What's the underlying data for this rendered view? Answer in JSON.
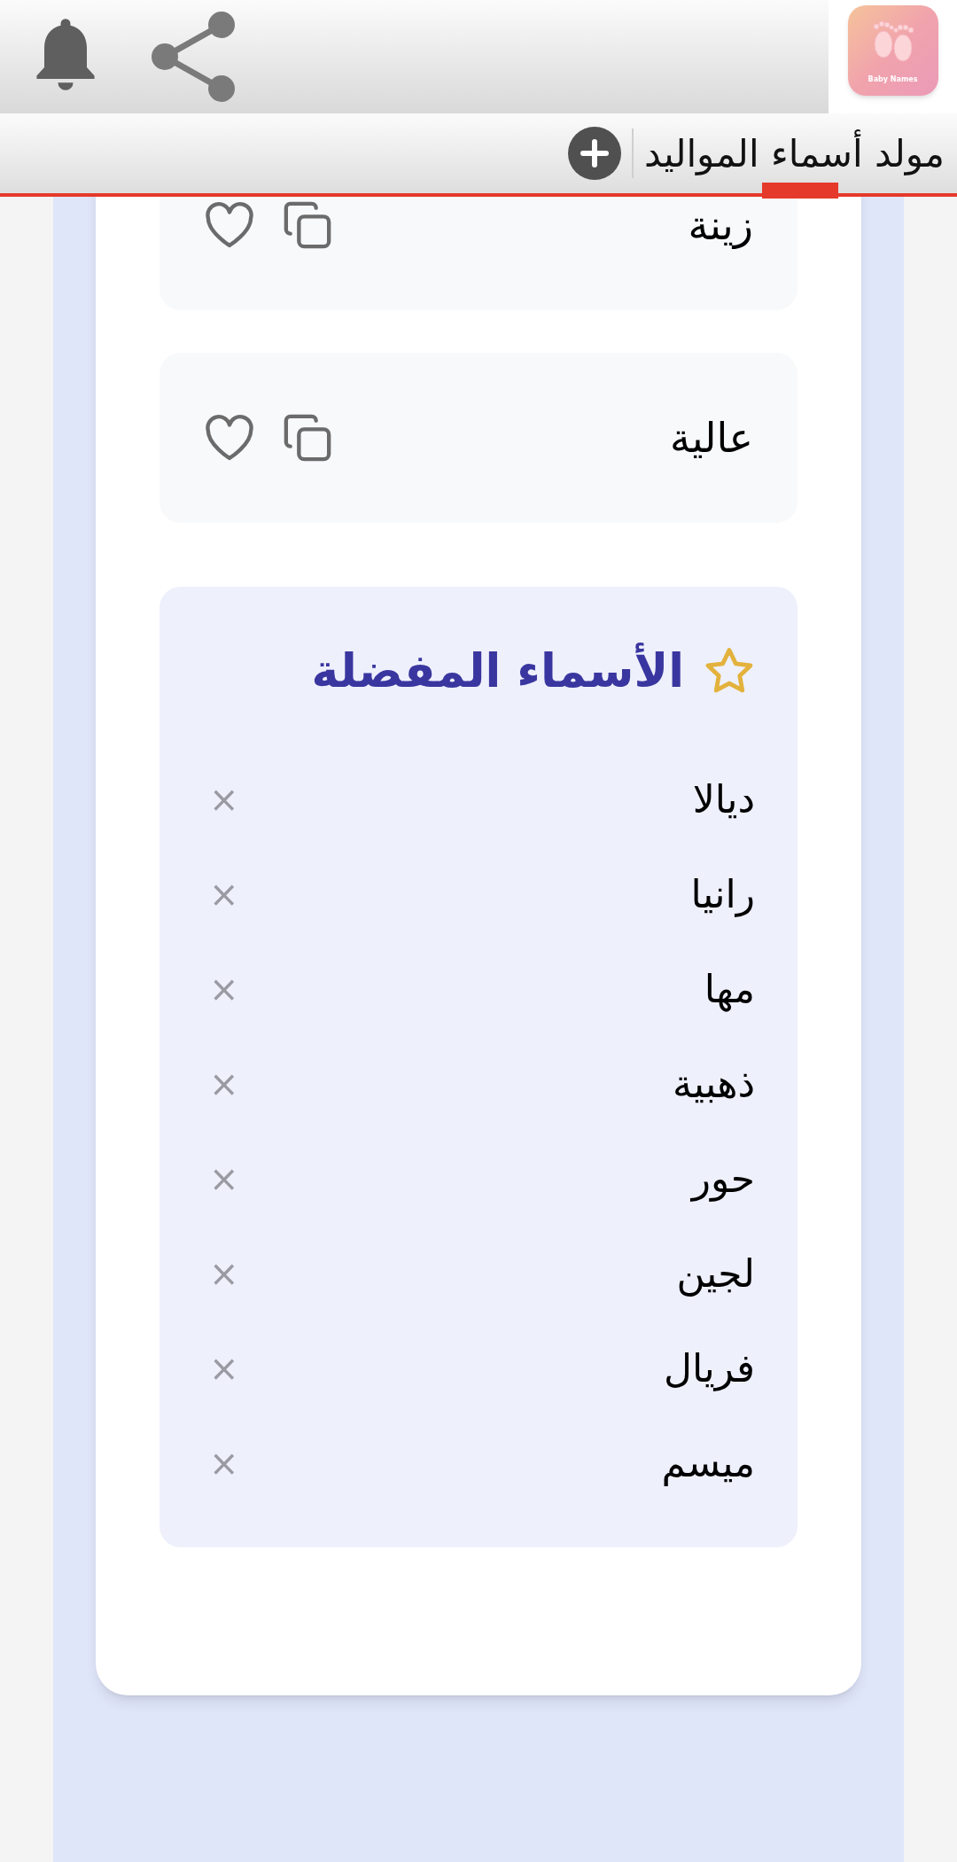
{
  "app_icon": {
    "label": "Baby Names"
  },
  "tabs": [
    {
      "label": "مولد أسماء المواليد",
      "selected": true
    }
  ],
  "name_cards": [
    {
      "name": "زينة"
    },
    {
      "name": "عالية"
    }
  ],
  "favorites": {
    "title": "الأسماء المفضلة",
    "items": [
      {
        "name": "ديالا",
        "remove": "×"
      },
      {
        "name": "رانيا",
        "remove": "×"
      },
      {
        "name": "مها",
        "remove": "×"
      },
      {
        "name": "ذهبية",
        "remove": "×"
      },
      {
        "name": "حور",
        "remove": "×"
      },
      {
        "name": "لجين",
        "remove": "×"
      },
      {
        "name": "فريال",
        "remove": "×"
      },
      {
        "name": "ميسم",
        "remove": "×"
      }
    ]
  }
}
